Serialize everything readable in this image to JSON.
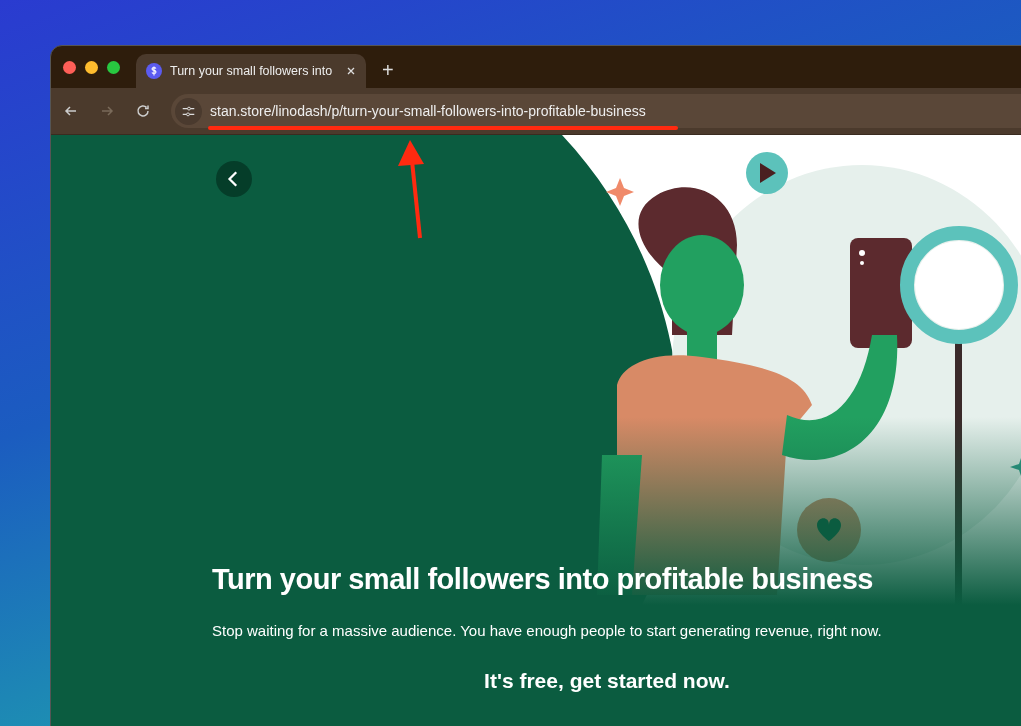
{
  "browser": {
    "tabs": [
      {
        "title": "Turn your small followers into",
        "selected": true
      }
    ],
    "new_tab": "+",
    "url": "stan.store/linodash/p/turn-your-small-followers-into-profitable-business"
  },
  "page": {
    "heading": "Turn your small followers into profitable business",
    "subtitle": "Stop waiting for a massive audience. You have enough people to start generating revenue, right now.",
    "cta": "It's free, get started now."
  }
}
